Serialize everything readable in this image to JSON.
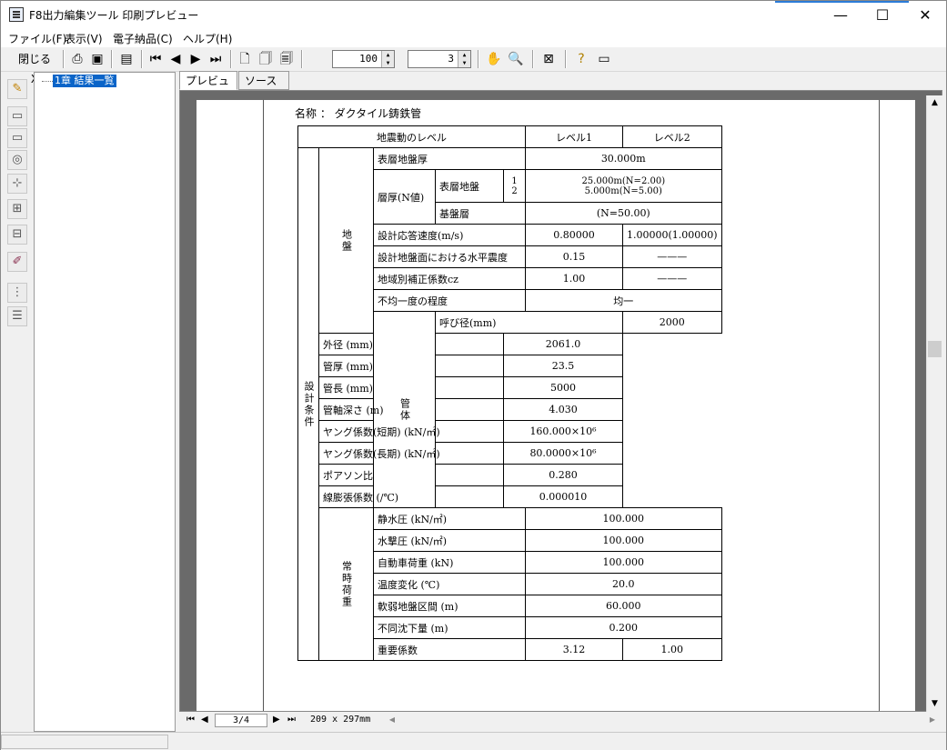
{
  "window": {
    "title": "F8出力編集ツール 印刷プレビュー",
    "minimize": "—",
    "maximize": "☐",
    "close": "✕"
  },
  "menu": [
    "ファイル(F)",
    "表示(V)",
    "電子納品(C)",
    "ヘルプ(H)"
  ],
  "toolbar": {
    "close_label": "閉じる(X)",
    "zoom_value": "100",
    "pages_value": "3"
  },
  "tree": {
    "node_label": "1章 結果一覧"
  },
  "tabs": [
    "プレビュー",
    "ソース"
  ],
  "document": {
    "name_line": "名称 ： ダクタイル鋳鉄管",
    "header": {
      "col1": "地震動のレベル",
      "level1": "レベル1",
      "level2": "レベル2"
    },
    "groups": {
      "outer": "設計条件",
      "ground": "地盤",
      "pipe": "管体",
      "load": "常時荷重"
    },
    "ground": {
      "surface_thickness": {
        "label": "表層地盤厚",
        "value": "30.000m"
      },
      "layer_label": "層厚(N値)",
      "surface_ground": "表層地盤",
      "sub_nums": [
        "1",
        "2"
      ],
      "surface_values": [
        "25.000m(N=2.00)",
        "5.000m(N=5.00)"
      ],
      "base_layer": "基盤層",
      "base_value": "(N=50.00)",
      "velocity": {
        "label": "設計応答速度(m/s)",
        "l1": "0.80000",
        "l2": "1.00000(1.00000)"
      },
      "seismic": {
        "label": "設計地盤面における水平震度",
        "l1": "0.15",
        "l2": "———"
      },
      "region": {
        "label": "地域別補正係数cz",
        "l1": "1.00",
        "l2": "———"
      },
      "nonuniform": {
        "label": "不均一度の程度",
        "value": "均一"
      }
    },
    "pipe": [
      {
        "label": "呼び径(mm)",
        "value": "2000"
      },
      {
        "label": "外径 (mm)",
        "value": "2061.0"
      },
      {
        "label": "管厚 (mm)",
        "value": "23.5"
      },
      {
        "label": "管長 (mm)",
        "value": "5000"
      },
      {
        "label": "管軸深さ (m)",
        "value": "4.030"
      },
      {
        "label": "ヤング係数(短期) (kN/㎡)",
        "value": "160.000×10⁶"
      },
      {
        "label": "ヤング係数(長期) (kN/㎡)",
        "value": "80.0000×10⁶"
      },
      {
        "label": "ポアソン比",
        "value": "0.280"
      },
      {
        "label": "線膨張係数 (/℃)",
        "value": "0.000010"
      }
    ],
    "load": [
      {
        "label": "静水圧 (kN/㎡)",
        "value": "100.000"
      },
      {
        "label": "水撃圧 (kN/㎡)",
        "value": "100.000"
      },
      {
        "label": "自動車荷重 (kN)",
        "value": "100.000"
      },
      {
        "label": "温度変化 (℃)",
        "value": "20.0"
      },
      {
        "label": "軟弱地盤区間 (m)",
        "value": "60.000"
      },
      {
        "label": "不同沈下量 (m)",
        "value": "0.200"
      }
    ],
    "importance": {
      "label": "重要係数",
      "l1": "3.12",
      "l2": "1.00"
    }
  },
  "pager": {
    "page": "3/4",
    "paper_size": "209 x 297mm"
  }
}
